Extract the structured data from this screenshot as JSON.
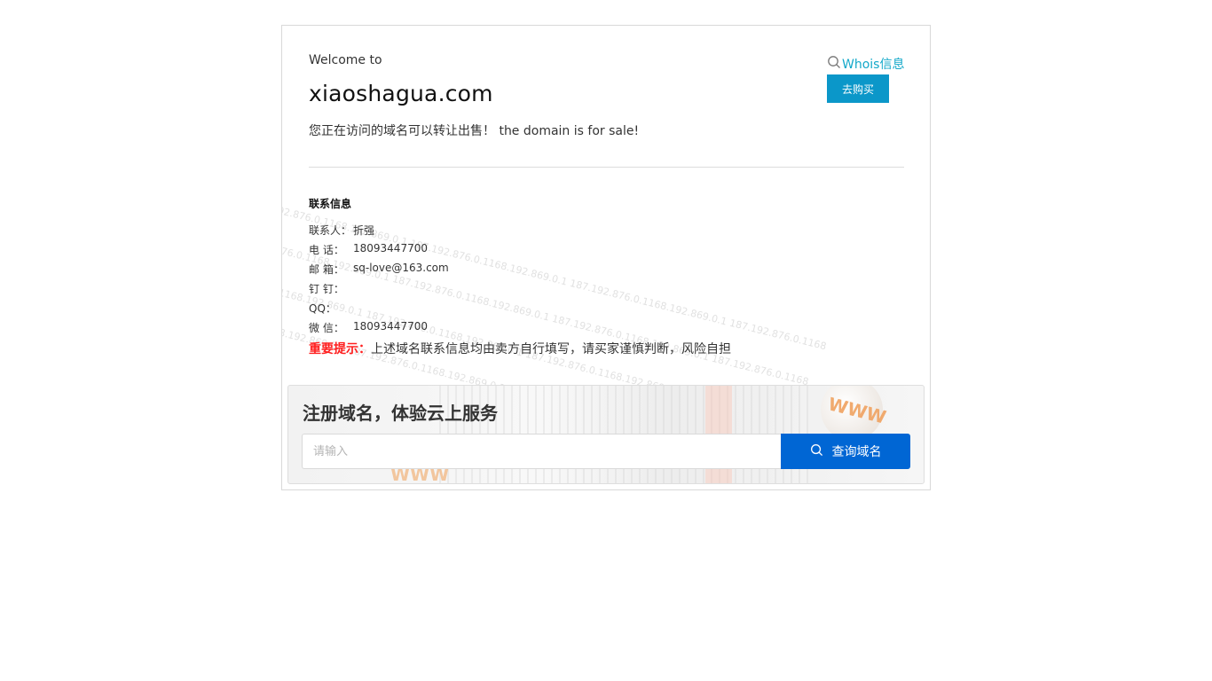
{
  "header": {
    "welcome": "Welcome to",
    "domain": "xiaoshagua.com",
    "sale_notice": "您正在访问的域名可以转让出售！ the domain is for sale!",
    "whois_label": "Whois信息",
    "buy_label": "去购买"
  },
  "contact": {
    "title": "联系信息",
    "rows": [
      {
        "label": "联系人：",
        "value": "折强"
      },
      {
        "label": "电 话：",
        "value": "18093447700"
      },
      {
        "label": "邮 箱：",
        "value": "sq-love@163.com"
      },
      {
        "label": "钉 钉：",
        "value": ""
      },
      {
        "label": "QQ：",
        "value": ""
      },
      {
        "label": "微 信：",
        "value": "18093447700"
      }
    ]
  },
  "warning": {
    "label": "重要提示：",
    "text": "上述域名联系信息均由卖方自行填写，请买家谨慎判断，风险自担"
  },
  "watermark": {
    "text": "192.876.0.1168.192.869.0.1 187.192.876.0.1168.192.869.0.1 187.192.876.0.1168.192.869.0.1 187.192.876.0.1168"
  },
  "register": {
    "title": "注册域名，体验云上服务",
    "placeholder": "请输入",
    "button_label": "查询域名",
    "stamp": "WWW"
  },
  "colors": {
    "whois_link": "#13a8c9",
    "buy_button": "#0b97c9",
    "query_button": "#0066d4",
    "warning_label": "#ff1f1f"
  },
  "icons": {
    "whois": "search-icon",
    "query": "search-icon"
  }
}
